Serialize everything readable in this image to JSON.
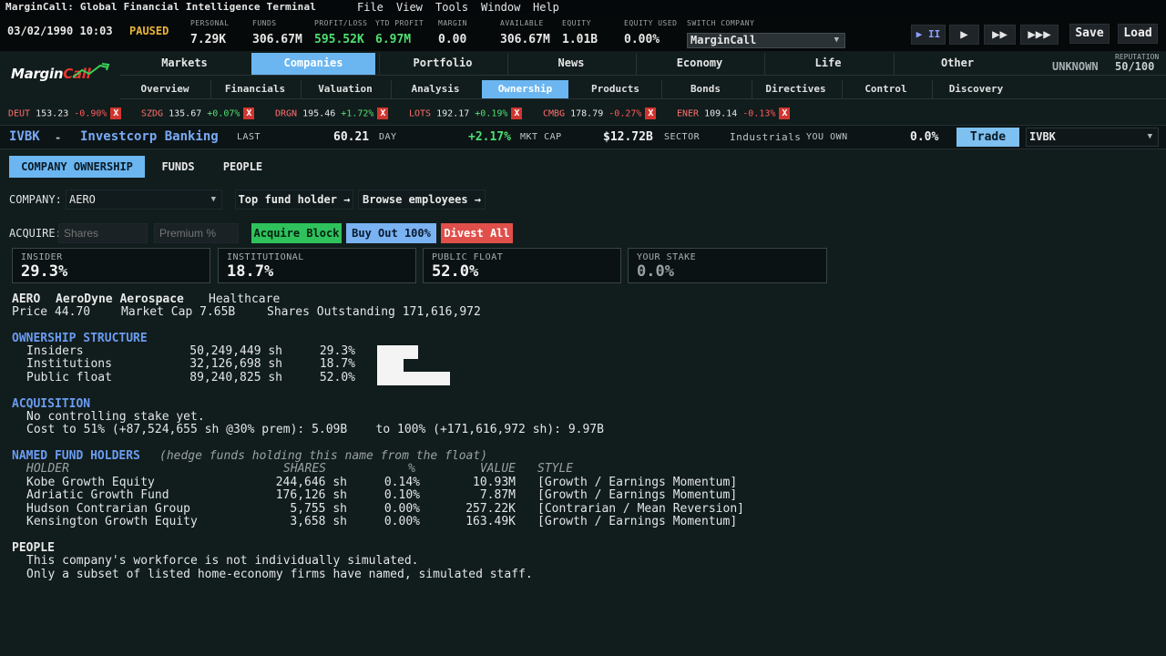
{
  "app": {
    "title": "MarginCall: Global Financial Intelligence Terminal",
    "menu": [
      "File",
      "View",
      "Tools",
      "Window",
      "Help"
    ]
  },
  "status": {
    "date": "03/02/1990 10:03",
    "state": "PAUSED",
    "stats": [
      {
        "label": "PERSONAL",
        "value": "7.29K"
      },
      {
        "label": "FUNDS",
        "value": "306.67M"
      },
      {
        "label": "PROFIT/LOSS",
        "value": "595.52K"
      },
      {
        "label": "YTD PROFIT",
        "value": "6.97M"
      },
      {
        "label": "MARGIN",
        "value": "0.00"
      },
      {
        "label": "AVAILABLE",
        "value": "306.67M"
      },
      {
        "label": "EQUITY",
        "value": "1.01B"
      },
      {
        "label": "EQUITY USED",
        "value": "0.00%"
      }
    ],
    "switch_label": "SWITCH COMPANY",
    "switch_value": "MarginCall",
    "controls": {
      "pause": "▶ II",
      "play": "▶",
      "fast": "▶▶",
      "fastest": "▶▶▶",
      "save": "Save",
      "load": "Load"
    }
  },
  "logo": {
    "part1": "Margin",
    "part2": "Call"
  },
  "nav": {
    "tabs": [
      "Markets",
      "Companies",
      "Portfolio",
      "News",
      "Economy",
      "Life",
      "Other"
    ],
    "active_tab": "Companies",
    "subtabs": [
      "Overview",
      "Financials",
      "Valuation",
      "Analysis",
      "Ownership",
      "Products",
      "Bonds",
      "Directives",
      "Control",
      "Discovery"
    ],
    "active_subtab": "Ownership",
    "unknown": "UNKNOWN",
    "reputation_label": "REPUTATION",
    "reputation_value": "50/100"
  },
  "tickers": [
    {
      "sym": "DEUT",
      "price": "153.23",
      "chg": "-0.90%"
    },
    {
      "sym": "SZDG",
      "price": "135.67",
      "chg": "+0.07%"
    },
    {
      "sym": "DRGN",
      "price": "195.46",
      "chg": "+1.72%"
    },
    {
      "sym": "LOTS",
      "price": "192.17",
      "chg": "+0.19%"
    },
    {
      "sym": "CMBG",
      "price": "178.79",
      "chg": "-0.27%"
    },
    {
      "sym": "ENER",
      "price": "109.14",
      "chg": "-0.13%"
    }
  ],
  "company": {
    "ticker": "IVBK",
    "sep": "-",
    "name": "Investcorp Banking",
    "last_label": "LAST",
    "last": "60.21",
    "day_label": "DAY",
    "day": "+2.17%",
    "mktcap_label": "MKT CAP",
    "mktcap": "$12.72B",
    "sector_label": "SECTOR",
    "sector": "Industrials",
    "own_label": "YOU OWN",
    "own": "0.0%",
    "trade": "Trade",
    "symbol_select": "IVBK"
  },
  "owner_tabs": [
    "COMPANY OWNERSHIP",
    "FUNDS",
    "PEOPLE"
  ],
  "controls": {
    "company_label": "COMPANY:",
    "company_value": "AERO",
    "top_fund": "Top fund holder →",
    "browse": "Browse employees →",
    "acquire_label": "ACQUIRE:",
    "shares_ph": "Shares",
    "premium_ph": "Premium %",
    "acquire_block": "Acquire Block",
    "buyout": "Buy Out 100%",
    "divest": "Divest All"
  },
  "cards": [
    {
      "label": "INSIDER",
      "value": "29.3%"
    },
    {
      "label": "INSTITUTIONAL",
      "value": "18.7%"
    },
    {
      "label": "PUBLIC FLOAT",
      "value": "52.0%"
    },
    {
      "label": "YOUR STAKE",
      "value": "0.0%"
    }
  ],
  "target": {
    "ticker": "AERO",
    "name": "AeroDyne Aerospace",
    "sector": "Healthcare",
    "price": "Price 44.70",
    "mktcap": "Market Cap 7.65B",
    "shares": "Shares Outstanding 171,616,972"
  },
  "structure": {
    "heading": "OWNERSHIP STRUCTURE",
    "rows": [
      {
        "name": "Insiders",
        "shares": "50,249,449 sh",
        "pct": "29.3%",
        "fraction": 0.293
      },
      {
        "name": "Institutions",
        "shares": "32,126,698 sh",
        "pct": "18.7%",
        "fraction": 0.187
      },
      {
        "name": "Public float",
        "shares": "89,240,825 sh",
        "pct": "52.0%",
        "fraction": 0.52
      }
    ]
  },
  "acquisition": {
    "heading": "ACQUISITION",
    "line1": "No controlling stake yet.",
    "line2": "Cost to 51% (+87,524,655 sh @30% prem): 5.09B    to 100% (+171,616,972 sh): 9.97B"
  },
  "funds": {
    "heading": "NAMED FUND HOLDERS",
    "note": "(hedge funds holding this name from the float)",
    "cols": [
      "HOLDER",
      "SHARES",
      "%",
      "VALUE",
      "STYLE"
    ],
    "rows": [
      {
        "holder": "Kobe Growth Equity",
        "shares": "244,646 sh",
        "pct": "0.14%",
        "value": "10.93M",
        "style": "[Growth / Earnings Momentum]"
      },
      {
        "holder": "Adriatic Growth Fund",
        "shares": "176,126 sh",
        "pct": "0.10%",
        "value": "7.87M",
        "style": "[Growth / Earnings Momentum]"
      },
      {
        "holder": "Hudson Contrarian Group",
        "shares": "5,755 sh",
        "pct": "0.00%",
        "value": "257.22K",
        "style": "[Contrarian / Mean Reversion]"
      },
      {
        "holder": "Kensington Growth Equity",
        "shares": "3,658 sh",
        "pct": "0.00%",
        "value": "163.49K",
        "style": "[Growth / Earnings Momentum]"
      }
    ]
  },
  "people": {
    "heading": "PEOPLE",
    "line1": "This company's workforce is not individually simulated.",
    "line2": "Only a subset of listed home-economy firms have named, simulated staff."
  },
  "colors": {
    "accent": "#6bb6f0",
    "positive": "#4fe070",
    "negative": "#ff5a5a",
    "heading": "#6a9cf0",
    "paused": "#e8b43a"
  }
}
